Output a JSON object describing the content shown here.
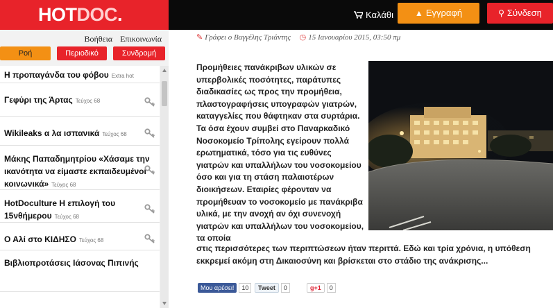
{
  "header": {
    "logo_hot": "HOT",
    "logo_doc": "DOC",
    "logo_dot": ".",
    "cart_label": "Καλάθι",
    "register_label": "Εγγραφή",
    "login_label": "Σύνδεση"
  },
  "sidebar": {
    "links": [
      "Βοήθεια",
      "Επικοινωνία"
    ],
    "tabs": [
      "Ροή",
      "Περιοδικό",
      "Συνδρομή"
    ],
    "items": [
      {
        "title": "Η προπαγάνδα του φόβου",
        "tag": "Extra hot",
        "locked": false
      },
      {
        "title": "Γεφύρι της Άρτας",
        "tag": "Τεύχος 68",
        "locked": true
      },
      {
        "title": "Wikileaks α λα ισπανικά",
        "tag": "Τεύχος 68",
        "locked": true
      },
      {
        "title": "Μάκης Παπαδημητρίου «Χάσαμε την ικανότητα να είμαστε εκπαιδευμένοι κοινωνικά»",
        "tag": "Τεύχος 68",
        "locked": true
      },
      {
        "title": "HotDoculture Η επιλογή του 15νθήμερου",
        "tag": "Τεύχος 68",
        "locked": true
      },
      {
        "title": "Ο Αλί στο ΚΙΔΗΣΟ",
        "tag": "Τεύχος 68",
        "locked": true
      },
      {
        "title": "Βιβλιοπροτάσεις Ιάσονας Πιπινής",
        "tag": "",
        "locked": false
      }
    ]
  },
  "article": {
    "author": "Γράφει ο Βαγγέλης Τριάντης",
    "date": "15 Ιανουαρίου 2015, 03:50 πμ",
    "body_column": "Προμήθειες πανάκριβων υλικών σε υπερβολικές ποσότητες, παράτυπες διαδικασίες ως προς την προμήθεια, πλαστογραφήσεις υπογραφών γιατρών, καταγγελίες που θάφτηκαν στα συρτάρια. Τα όσα έχουν συμβεί στο Παναρκαδικό Νοσοκομείο Τρίπολης εγείρουν πολλά ερωτηματικά, τόσο για τις ευθύνες γιατρών και υπαλλήλων του νοσοκομείου όσο και για τη στάση παλαιοτέρων διοικήσεων. Εταιρίες φέρονταν να προμήθευαν το νοσοκομείο με πανάκριβα υλικά, με την ανοχή αν όχι συνενοχή γιατρών και υπαλλήλων του νοσοκομείου, τα οποία",
    "body_wide": "στις περισσότερες των περιπτώσεων ήταν περιττά. Εδώ και τρία χρόνια, η υπόθεση εκκρεμεί ακόμη στη Δικαιοσύνη και βρίσκεται στο στάδιο της ανάκρισης..."
  },
  "social": {
    "facebook_label": "Μου αρέσει!",
    "facebook_count": "10",
    "tweet_label": "Tweet",
    "tweet_count": "0",
    "gplus_label": "g+1",
    "gplus_count": "0"
  },
  "colors": {
    "brand_red": "#e8232a",
    "accent_orange": "#f39014",
    "topbar": "#0a0a0a"
  },
  "icons": [
    "cart-icon",
    "user-icon",
    "key-icon",
    "pen-icon",
    "clock-icon",
    "lock-key-icon"
  ]
}
